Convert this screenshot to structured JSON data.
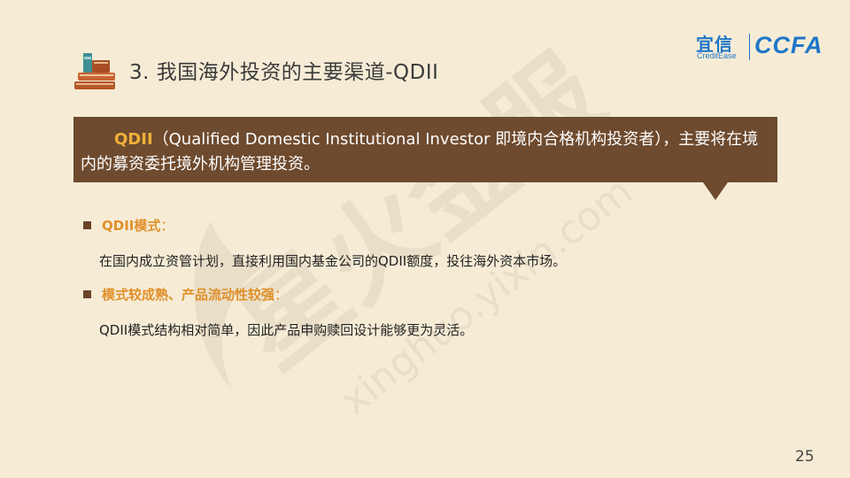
{
  "header": {
    "title": "3. 我国海外投资的主要渠道-QDII",
    "logo": {
      "yixin": "宜信",
      "credit_ease": "CreditEase",
      "ccfa": "CCFA"
    }
  },
  "callout": {
    "highlight": "QDII",
    "text": "（Qualified Domestic Institutional Investor 即境内合格机构投资者），主要将在境内的募资委托境外机构管理投资。"
  },
  "sections": [
    {
      "heading": "QDII模式",
      "colon": "：",
      "body": "在国内成立资管计划，直接利用国内基金公司的QDII额度，投往海外资本市场。"
    },
    {
      "heading": "模式较成熟、产品流动性较强",
      "colon": "：",
      "body": "QDII模式结构相对简单，因此产品申购赎回设计能够更为灵活。"
    }
  ],
  "watermark": {
    "cn": "星火金服",
    "url": "xinghuo.yixin.com"
  },
  "page_number": "25",
  "colors": {
    "background": "#f6ecd6",
    "callout": "#6e4a2e",
    "highlight": "#f1b13a",
    "heading": "#e0902a",
    "brand": "#1f76c8"
  }
}
